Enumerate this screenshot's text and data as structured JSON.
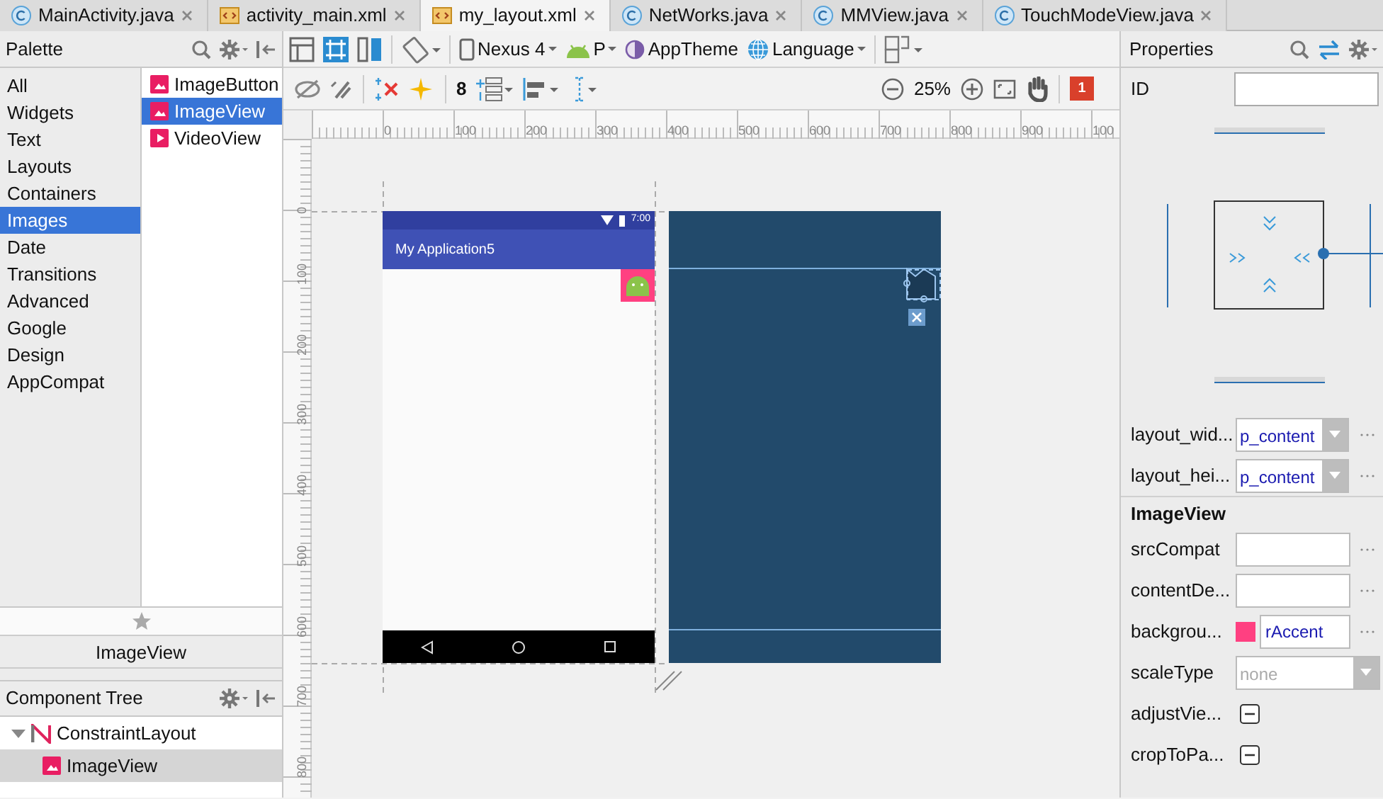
{
  "tabs": [
    {
      "label": "MainActivity.java",
      "kind": "class",
      "selected": false
    },
    {
      "label": "activity_main.xml",
      "kind": "xml",
      "selected": false
    },
    {
      "label": "my_layout.xml",
      "kind": "xml",
      "selected": true
    },
    {
      "label": "NetWorks.java",
      "kind": "class",
      "selected": false
    },
    {
      "label": "MMView.java",
      "kind": "class",
      "selected": false
    },
    {
      "label": "TouchModeView.java",
      "kind": "class",
      "selected": false
    }
  ],
  "palette": {
    "title": "Palette",
    "categories": [
      {
        "label": "All",
        "selected": false
      },
      {
        "label": "Widgets",
        "selected": false
      },
      {
        "label": "Text",
        "selected": false
      },
      {
        "label": "Layouts",
        "selected": false
      },
      {
        "label": "Containers",
        "selected": false
      },
      {
        "label": "Images",
        "selected": true
      },
      {
        "label": "Date",
        "selected": false
      },
      {
        "label": "Transitions",
        "selected": false
      },
      {
        "label": "Advanced",
        "selected": false
      },
      {
        "label": "Google",
        "selected": false
      },
      {
        "label": "Design",
        "selected": false
      },
      {
        "label": "AppCompat",
        "selected": false
      }
    ],
    "items": [
      {
        "label": "ImageButton",
        "kind": "image",
        "selected": false
      },
      {
        "label": "ImageView",
        "kind": "image",
        "selected": true
      },
      {
        "label": "VideoView",
        "kind": "video",
        "selected": false
      }
    ],
    "preview_label": "ImageView"
  },
  "component_tree": {
    "title": "Component Tree",
    "nodes": [
      {
        "label": "ConstraintLayout",
        "expanded": true,
        "selected": false,
        "children": [
          {
            "label": "ImageView",
            "selected": true
          }
        ]
      }
    ]
  },
  "toolbar": {
    "device": "Nexus 4",
    "api": "P",
    "theme": "AppTheme",
    "language": "Language",
    "text_size": "8",
    "zoom": "25%",
    "error_count": "1"
  },
  "rulers": {
    "horizontal": [
      "0",
      "100",
      "200",
      "300",
      "400",
      "500",
      "600",
      "700",
      "800",
      "900",
      "100"
    ],
    "vertical": [
      "0",
      "100",
      "200",
      "300",
      "400",
      "500",
      "600",
      "700",
      "800"
    ]
  },
  "design": {
    "status_time": "7:00",
    "app_title": "My Application5"
  },
  "properties": {
    "title": "Properties",
    "id_label": "ID",
    "rows": [
      {
        "kind": "dropdown",
        "label": "layout_wid...",
        "value": "p_content",
        "more": true
      },
      {
        "kind": "dropdown",
        "label": "layout_hei...",
        "value": "p_content",
        "more": true
      },
      {
        "kind": "section",
        "label": "ImageView"
      },
      {
        "kind": "text",
        "label": "srcCompat",
        "more": true
      },
      {
        "kind": "text",
        "label": "contentDe...",
        "more": true
      },
      {
        "kind": "color",
        "label": "backgrou...",
        "value": "rAccent",
        "color": "#ff4081",
        "more": true
      },
      {
        "kind": "dropdown",
        "label": "scaleType",
        "placeholder": "none",
        "more": false
      },
      {
        "kind": "tristate",
        "label": "adjustVie...",
        "indeterminate": true
      },
      {
        "kind": "tristate",
        "label": "cropToPa...",
        "indeterminate": true
      }
    ]
  }
}
